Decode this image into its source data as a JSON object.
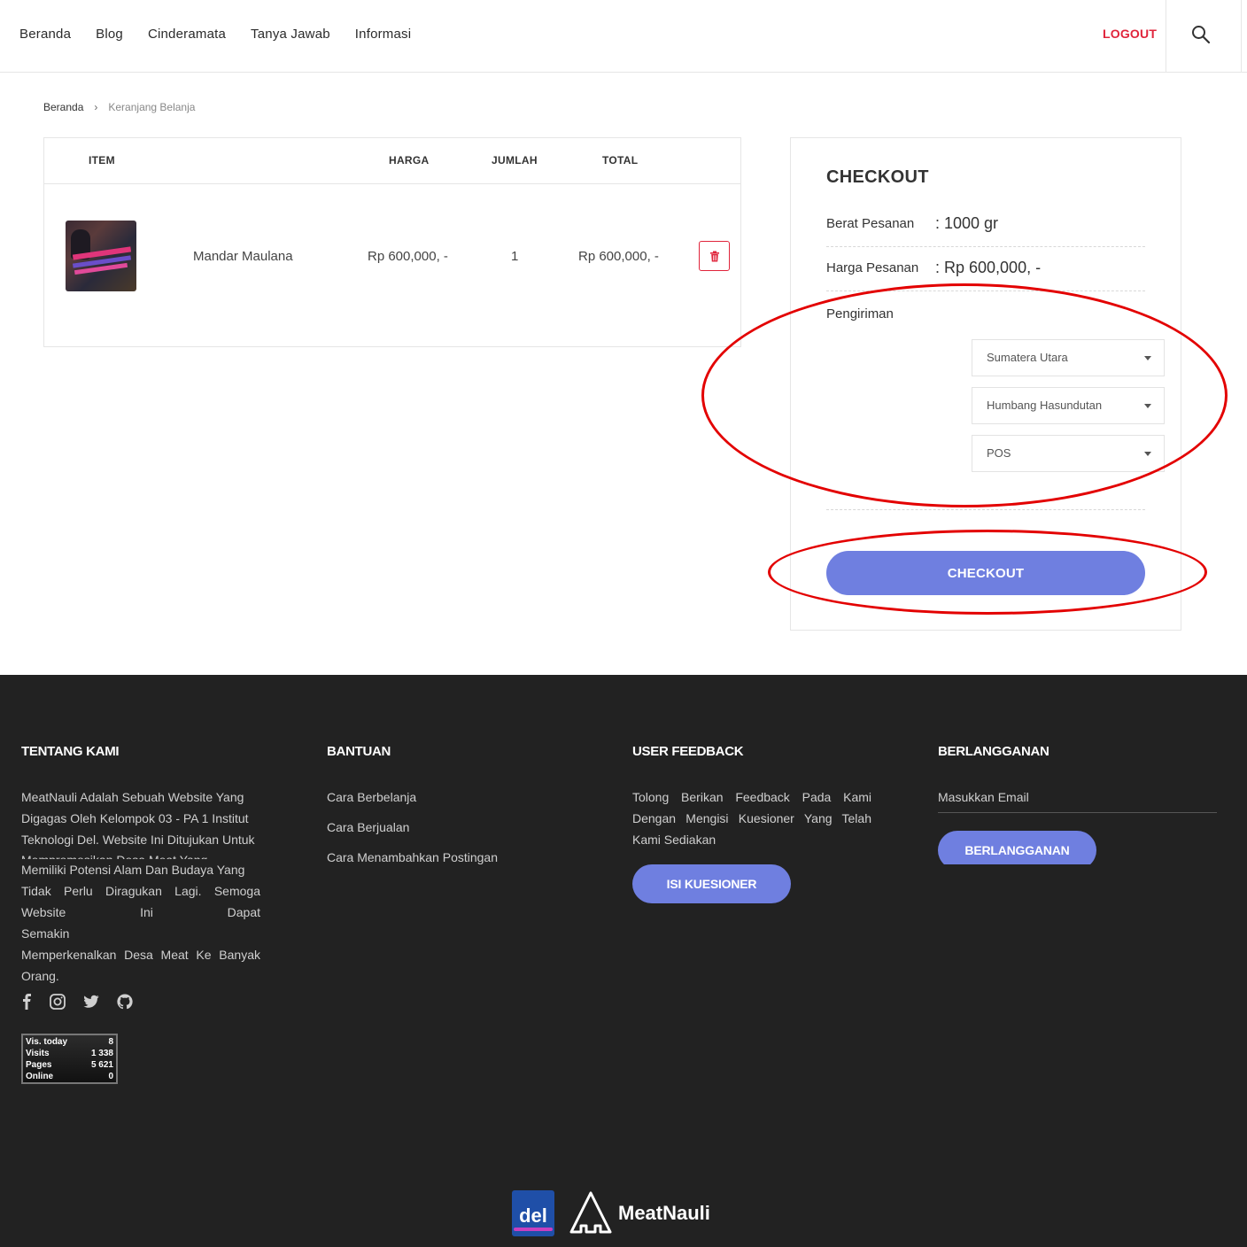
{
  "nav": {
    "items": [
      "Beranda",
      "Blog",
      "Cinderamata",
      "Tanya Jawab",
      "Informasi"
    ],
    "logout": "LOGOUT"
  },
  "breadcrumb": {
    "home": "Beranda",
    "separator": "›",
    "current": "Keranjang Belanja"
  },
  "cart": {
    "headers": {
      "item": "ITEM",
      "price": "HARGA",
      "qty": "JUMLAH",
      "total": "TOTAL"
    },
    "rows": [
      {
        "name": "Mandar Maulana",
        "price": "Rp 600,000, -",
        "qty": "1",
        "total": "Rp 600,000, -"
      }
    ]
  },
  "checkout": {
    "title": "CHECKOUT",
    "weight_label": "Berat Pesanan",
    "weight_value": ": 1000 gr",
    "price_label": "Harga Pesanan",
    "price_value": ": Rp 600,000, -",
    "shipping_label": "Pengiriman",
    "province": "Sumatera Utara",
    "regency": "Humbang Hasundutan",
    "courier": "POS",
    "button": "CHECKOUT"
  },
  "footer": {
    "about": {
      "title": "TENTANG KAMI",
      "text_lines": [
        "MeatNauli Adalah Sebuah Website Yang",
        "Digagas Oleh Kelompok 03 - PA 1 Institut",
        "Teknologi Del. Website Ini Ditujukan Untuk",
        "Mempromosikan Desa Meat Yang",
        "Memiliki Potensi Alam Dan Budaya Yang",
        "Tidak Perlu Diragukan Lagi. Semoga",
        "Website Ini Dapat Semakin",
        "Memperkenalkan Desa Meat Ke Banyak",
        "Orang."
      ]
    },
    "help": {
      "title": "BANTUAN",
      "links": [
        "Cara Berbelanja",
        "Cara Berjualan",
        "Cara Menambahkan Postingan"
      ]
    },
    "feedback": {
      "title": "USER FEEDBACK",
      "text_lines": [
        "Tolong Berikan Feedback Pada Kami",
        "Dengan Mengisi Kuesioner Yang Telah",
        "Kami Sediakan"
      ],
      "button": "ISI KUESIONER"
    },
    "subscribe": {
      "title": "BERLANGGANAN",
      "placeholder": "Masukkan Email",
      "button": "BERLANGGANAN"
    },
    "socials": [
      "facebook-icon",
      "instagram-icon",
      "twitter-icon",
      "github-icon"
    ],
    "stats": [
      {
        "label": "Vis. today",
        "value": "8"
      },
      {
        "label": "Visits",
        "value": "1 338"
      },
      {
        "label": "Pages",
        "value": "5 621"
      },
      {
        "label": "Online",
        "value": "0"
      }
    ],
    "del_logo_text": "del",
    "brand": "MeatNauli"
  },
  "colors": {
    "accent": "#6f7fe0",
    "logout": "#e0243b",
    "footer_bg": "#222222",
    "annotation": "#e30000"
  }
}
